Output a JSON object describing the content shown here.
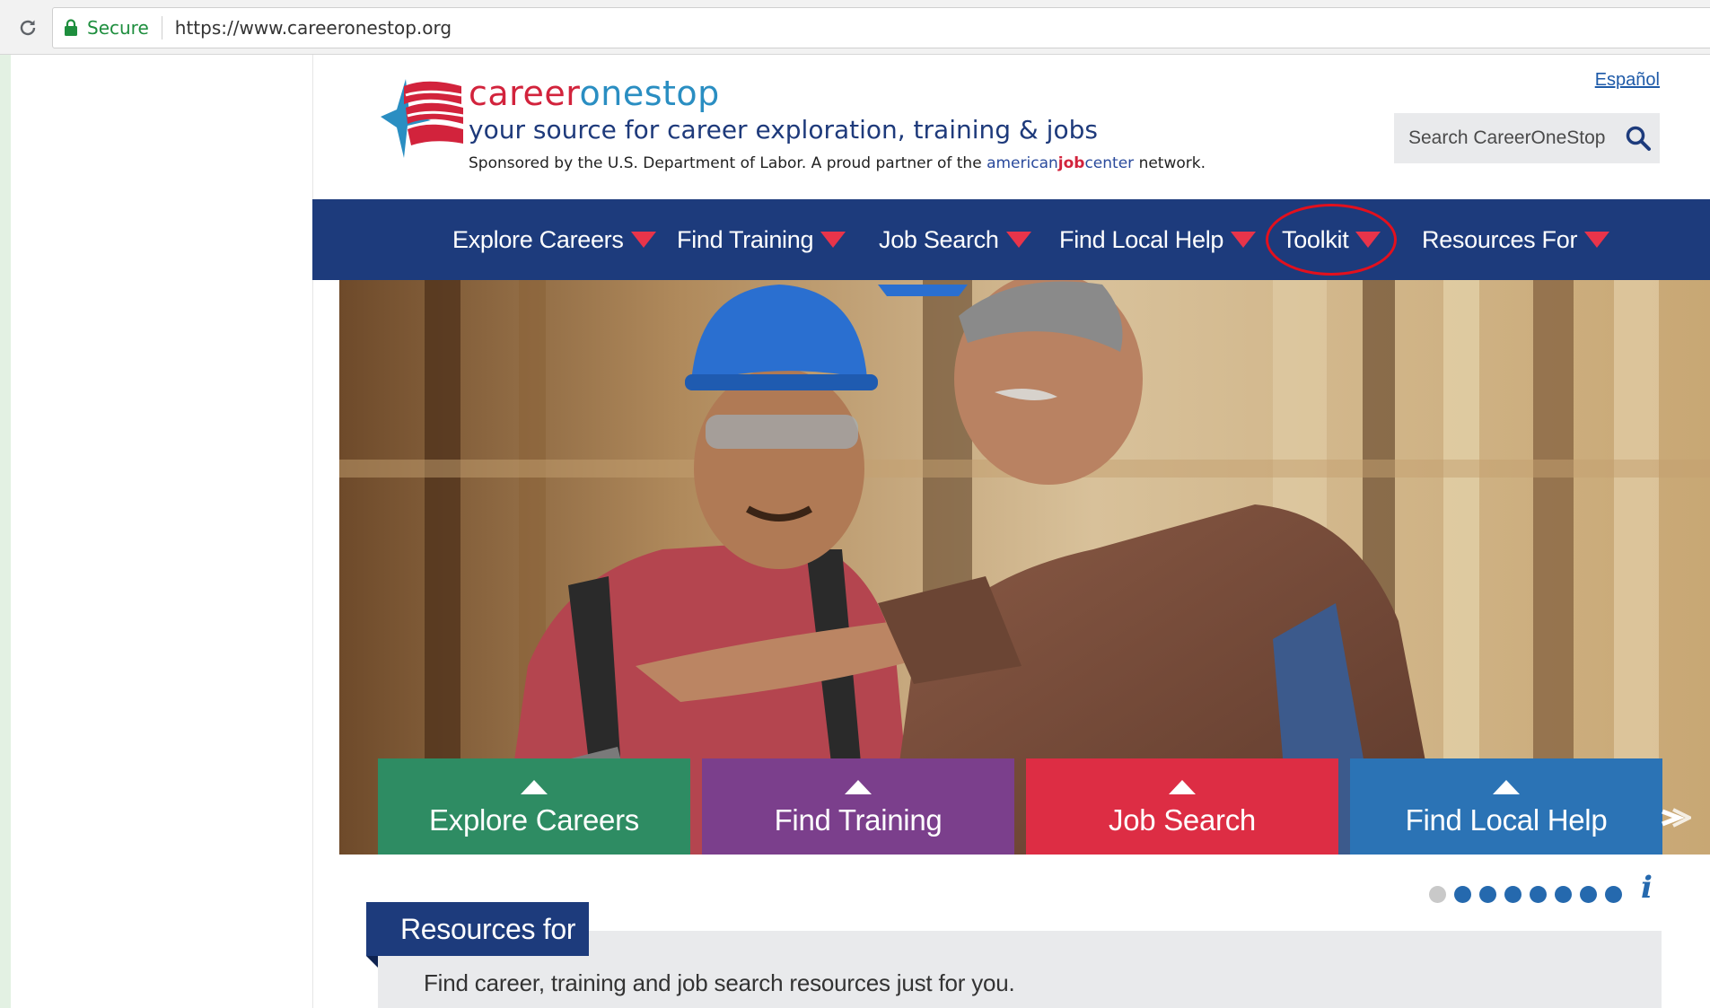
{
  "browser": {
    "secure_label": "Secure",
    "url": "https://www.careeronestop.org"
  },
  "header": {
    "brand_part1": "career",
    "brand_part2": "onestop",
    "tagline": "your source for career exploration, training & jobs",
    "sponsor_prefix": "Sponsored by the U.S. Department of Labor. A proud partner of the",
    "ajc_part1": "american",
    "ajc_part2": "job",
    "ajc_part3": "center",
    "sponsor_suffix": "network.",
    "language_link": "Español",
    "search_placeholder": "Search CareerOneStop"
  },
  "nav": {
    "items": [
      {
        "label": "Explore Careers"
      },
      {
        "label": "Find Training"
      },
      {
        "label": "Job Search"
      },
      {
        "label": "Find Local Help"
      },
      {
        "label": "Toolkit"
      },
      {
        "label": "Resources For"
      }
    ],
    "highlighted": "Toolkit"
  },
  "hero": {
    "tiles": [
      {
        "label": "Explore Careers",
        "color": "#2e8c63"
      },
      {
        "label": "Find Training",
        "color": "#7b3f8c"
      },
      {
        "label": "Job Search",
        "color": "#dd2d44"
      },
      {
        "label": "Find Local Help",
        "color": "#2b73b5"
      }
    ]
  },
  "carousel": {
    "total_dots": 8,
    "active_index": 0
  },
  "resources": {
    "tab_label": "Resources for",
    "description": "Find career, training and job search resources just for you."
  },
  "colors": {
    "nav_background": "#1d3b7c",
    "caret_red": "#e8344a",
    "brand_red": "#d2233c",
    "brand_blue": "#2a8ec2"
  }
}
